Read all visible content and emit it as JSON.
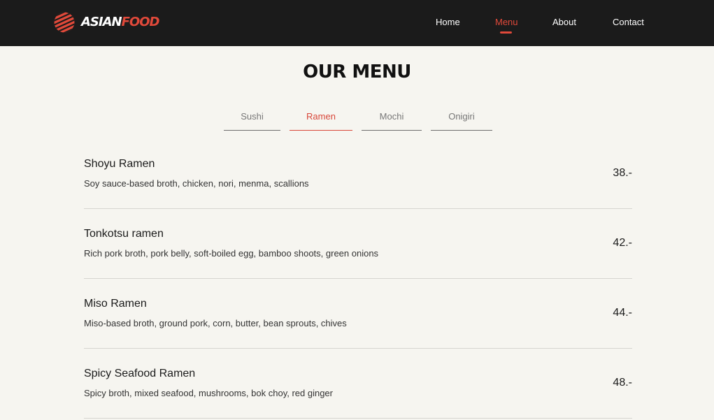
{
  "brand": {
    "logo_asian": "ASIAN",
    "logo_food": "FOOD",
    "accent_color": "#e0493a",
    "logo_icon": "striped-circle-icon"
  },
  "nav": {
    "items": [
      {
        "label": "Home"
      },
      {
        "label": "Menu",
        "active": true
      },
      {
        "label": "About"
      },
      {
        "label": "Contact"
      }
    ]
  },
  "page": {
    "title": "OUR MENU"
  },
  "tabs": [
    {
      "label": "Sushi"
    },
    {
      "label": "Ramen",
      "active": true
    },
    {
      "label": "Mochi"
    },
    {
      "label": "Onigiri"
    }
  ],
  "menu": {
    "items": [
      {
        "name": "Shoyu Ramen",
        "description": "Soy sauce-based broth, chicken, nori, menma, scallions",
        "price": "38.-"
      },
      {
        "name": "Tonkotsu ramen",
        "description": "Rich pork broth, pork belly, soft-boiled egg, bamboo shoots, green onions",
        "price": "42.-"
      },
      {
        "name": "Miso Ramen",
        "description": "Miso-based broth, ground pork, corn, butter, bean sprouts, chives",
        "price": "44.-"
      },
      {
        "name": "Spicy Seafood Ramen",
        "description": "Spicy broth, mixed seafood, mushrooms, bok choy, red ginger",
        "price": "48.-"
      }
    ]
  }
}
